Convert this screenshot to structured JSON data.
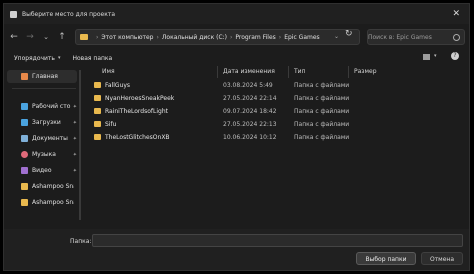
{
  "window": {
    "title": "Выберите место для проекта",
    "close_glyph": "✕"
  },
  "nav": {
    "back": "←",
    "forward": "→",
    "recent": "⌄",
    "up": "↑",
    "breadcrumbs": [
      "Этот компьютер",
      "Локальный диск (C:)",
      "Program Files",
      "Epic Games"
    ],
    "separator": "›",
    "addr_chevron": "⌄",
    "refresh": "↻",
    "search_placeholder": "Поиск в: Epic Games"
  },
  "toolbar": {
    "organize_label": "Упорядочить",
    "organize_arrow": "▾",
    "new_folder_label": "Новая папка",
    "view_arrow": "▾",
    "help_glyph": "?"
  },
  "sidebar": {
    "items": [
      {
        "label": "Главная",
        "icon": "home-icon",
        "color": "#e8894a",
        "pinned": false
      },
      {
        "label": "Рабочий сто",
        "icon": "desktop-icon",
        "color": "#4aa3df",
        "pinned": true
      },
      {
        "label": "Загрузки",
        "icon": "downloads-icon",
        "color": "#4aa3df",
        "pinned": true
      },
      {
        "label": "Документы",
        "icon": "documents-icon",
        "color": "#7fb0d8",
        "pinned": true
      },
      {
        "label": "Музыка",
        "icon": "music-icon",
        "color": "#e06a7a",
        "pinned": true
      },
      {
        "label": "Видео",
        "icon": "video-icon",
        "color": "#a070d0",
        "pinned": true
      },
      {
        "label": "Ashampoo Snap",
        "icon": "folder-icon",
        "color": "#e9b94e",
        "pinned": false
      },
      {
        "label": "Ashampoo Snap",
        "icon": "folder-icon",
        "color": "#e9b94e",
        "pinned": false
      }
    ],
    "pin_glyph": "✦"
  },
  "columns": {
    "name": "Имя",
    "date": "Дата изменения",
    "type": "Тип",
    "size": "Размер"
  },
  "files": [
    {
      "name": "FallGuys",
      "date": "03.08.2024 5:49",
      "type": "Папка с файлами"
    },
    {
      "name": "NyanHeroesSneakPeek",
      "date": "27.05.2024 22:14",
      "type": "Папка с файлами"
    },
    {
      "name": "RainiTheLordsofLight",
      "date": "09.07.2024 18:42",
      "type": "Папка с файлами"
    },
    {
      "name": "Sifu",
      "date": "27.05.2024 22:13",
      "type": "Папка с файлами"
    },
    {
      "name": "TheLostGlitchesOnXB",
      "date": "10.06.2024 10:12",
      "type": "Папка с файлами"
    }
  ],
  "footer": {
    "filename_label": "Папка:",
    "filename_value": "",
    "select_button": "Выбор папки",
    "cancel_button": "Отмена"
  },
  "colors": {
    "folder": "#e9b94e",
    "background": "#1c1c1c"
  }
}
